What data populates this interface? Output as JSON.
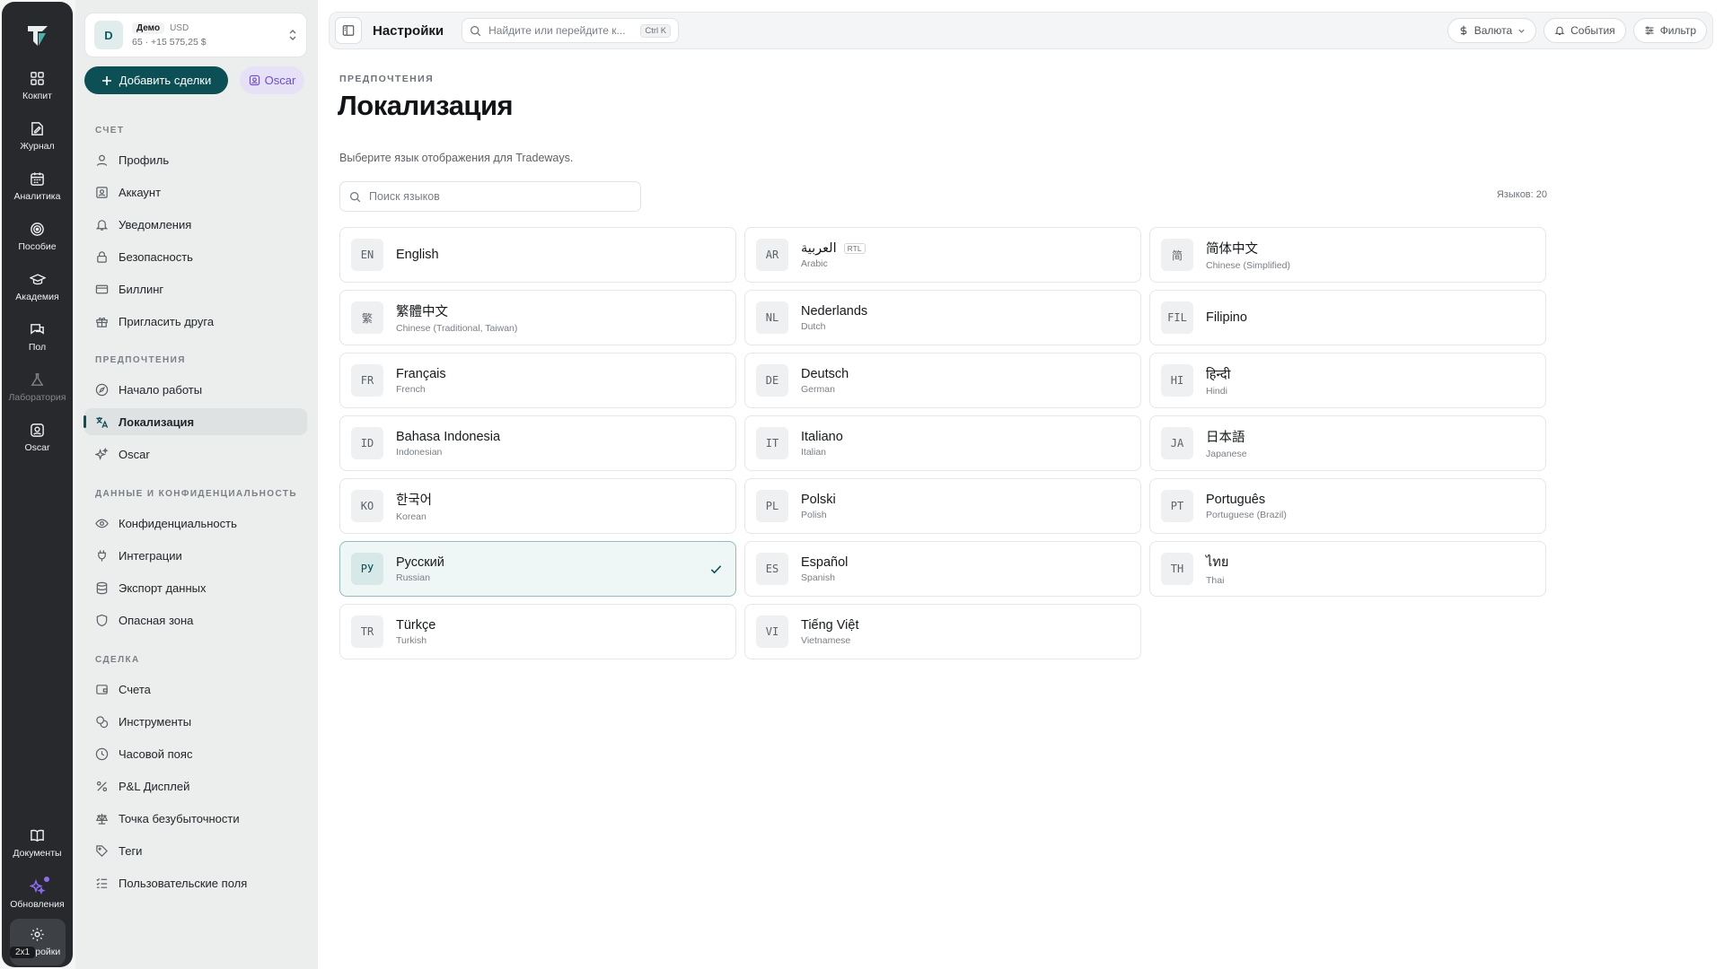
{
  "rail": {
    "items": [
      {
        "label": "Кокпит",
        "icon": "dashboard-icon"
      },
      {
        "label": "Журнал",
        "icon": "journal-icon"
      },
      {
        "label": "Аналитика",
        "icon": "analytics-icon"
      },
      {
        "label": "Пособие",
        "icon": "target-icon"
      },
      {
        "label": "Академия",
        "icon": "graduation-cap-icon"
      },
      {
        "label": "Пол",
        "icon": "chat-icon"
      },
      {
        "label": "Лаборатория",
        "icon": "flask-icon"
      },
      {
        "label": "Oscar",
        "icon": "oscar-icon"
      }
    ],
    "bottom": [
      {
        "label": "Документы",
        "icon": "book-icon"
      },
      {
        "label": "Обновления",
        "icon": "sparkle-icon"
      },
      {
        "label": "Настройки",
        "icon": "gear-icon"
      }
    ],
    "badge": "2x1"
  },
  "account": {
    "avatar": "D",
    "mode": "Демо",
    "currency": "USD",
    "summary": "65 · +15 575,25 $"
  },
  "actions": {
    "add_trades": "Добавить сделки",
    "oscar": "Oscar"
  },
  "sidebar": {
    "sections": [
      {
        "title": "СЧЕТ",
        "items": [
          {
            "label": "Профиль",
            "icon": "user-icon"
          },
          {
            "label": "Аккаунт",
            "icon": "id-card-icon"
          },
          {
            "label": "Уведомления",
            "icon": "bell-icon"
          },
          {
            "label": "Безопасность",
            "icon": "lock-icon"
          },
          {
            "label": "Биллинг",
            "icon": "credit-card-icon"
          },
          {
            "label": "Пригласить друга",
            "icon": "gift-icon"
          }
        ]
      },
      {
        "title": "ПРЕДПОЧТЕНИЯ",
        "items": [
          {
            "label": "Начало работы",
            "icon": "compass-icon"
          },
          {
            "label": "Локализация",
            "icon": "translate-icon",
            "active": true
          },
          {
            "label": "Oscar",
            "icon": "sparkles-icon"
          }
        ]
      },
      {
        "title": "ДАННЫЕ И КОНФИДЕНЦИАЛЬНОСТЬ",
        "items": [
          {
            "label": "Конфиденциальность",
            "icon": "eye-icon"
          },
          {
            "label": "Интеграции",
            "icon": "plug-icon"
          },
          {
            "label": "Экспорт данных",
            "icon": "database-icon"
          },
          {
            "label": "Опасная зона",
            "icon": "shield-icon"
          }
        ]
      },
      {
        "title": "СДЕЛКА",
        "items": [
          {
            "label": "Счета",
            "icon": "wallet-icon"
          },
          {
            "label": "Инструменты",
            "icon": "coins-icon"
          },
          {
            "label": "Часовой пояс",
            "icon": "clock-icon"
          },
          {
            "label": "P&L Дисплей",
            "icon": "percent-icon"
          },
          {
            "label": "Точка безубыточности",
            "icon": "scale-icon"
          },
          {
            "label": "Теги",
            "icon": "tag-icon"
          },
          {
            "label": "Пользовательские поля",
            "icon": "list-icon"
          }
        ]
      }
    ]
  },
  "topbar": {
    "title": "Настройки",
    "search_placeholder": "Найдите или перейдите к...",
    "search_shortcut": "Ctrl K",
    "currency": "Валюта",
    "events": "События",
    "filter": "Фильтр"
  },
  "page": {
    "eyebrow": "ПРЕДПОЧТЕНИЯ",
    "title": "Локализация",
    "description": "Выберите язык отображения для Tradeways.",
    "search_placeholder": "Поиск языков",
    "count": "Языков: 20"
  },
  "languages": [
    {
      "code": "EN",
      "name": "English",
      "sub": ""
    },
    {
      "code": "AR",
      "name": "العربية",
      "sub": "Arabic",
      "tag": "RTL"
    },
    {
      "code": "简",
      "name": "简体中文",
      "sub": "Chinese (Simplified)"
    },
    {
      "code": "繁",
      "name": "繁體中文",
      "sub": "Chinese (Traditional, Taiwan)"
    },
    {
      "code": "NL",
      "name": "Nederlands",
      "sub": "Dutch"
    },
    {
      "code": "FIL",
      "name": "Filipino",
      "sub": ""
    },
    {
      "code": "FR",
      "name": "Français",
      "sub": "French"
    },
    {
      "code": "DE",
      "name": "Deutsch",
      "sub": "German"
    },
    {
      "code": "HI",
      "name": "हिन्दी",
      "sub": "Hindi"
    },
    {
      "code": "ID",
      "name": "Bahasa Indonesia",
      "sub": "Indonesian"
    },
    {
      "code": "IT",
      "name": "Italiano",
      "sub": "Italian"
    },
    {
      "code": "JA",
      "name": "日本語",
      "sub": "Japanese"
    },
    {
      "code": "KO",
      "name": "한국어",
      "sub": "Korean"
    },
    {
      "code": "PL",
      "name": "Polski",
      "sub": "Polish"
    },
    {
      "code": "PT",
      "name": "Português",
      "sub": "Portuguese (Brazil)"
    },
    {
      "code": "РУ",
      "name": "Русский",
      "sub": "Russian",
      "selected": true
    },
    {
      "code": "ES",
      "name": "Español",
      "sub": "Spanish"
    },
    {
      "code": "TH",
      "name": "ไทย",
      "sub": "Thai"
    },
    {
      "code": "TR",
      "name": "Türkçe",
      "sub": "Turkish"
    },
    {
      "code": "VI",
      "name": "Tiếng Việt",
      "sub": "Vietnamese"
    }
  ]
}
